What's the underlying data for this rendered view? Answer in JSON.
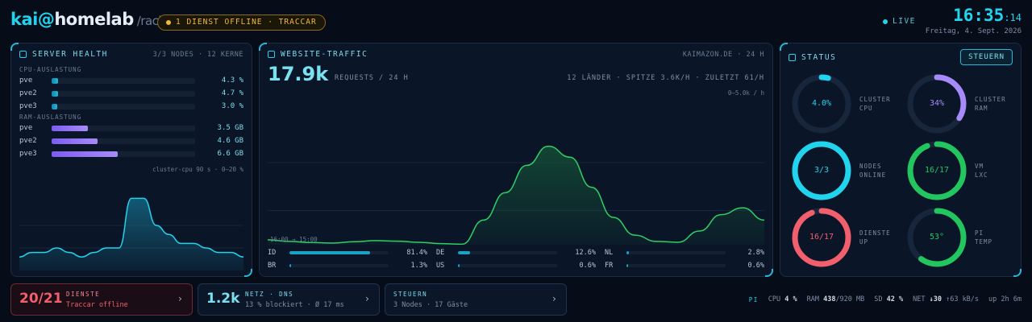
{
  "header": {
    "user": "kai@",
    "host": "homelab",
    "path": "/rack",
    "alert": "1 DIENST OFFLINE · TRACCAR",
    "live": "LIVE",
    "time": "16:35",
    "seconds": ":14",
    "date": "Freitag, 4. Sept. 2026"
  },
  "colors": {
    "accent": "#22d3ee",
    "warn": "#f4b93a",
    "ok": "#22c55e",
    "bad": "#f25f6c",
    "ram": "#a78bfa"
  },
  "server_health": {
    "title": "SERVER HEALTH",
    "meta": "3/3 NODES · 12 KERNE",
    "cpu_label": "CPU-AUSLASTUNG",
    "cpu": [
      {
        "name": "pve",
        "value": "4.3 %",
        "pct": 4.3
      },
      {
        "name": "pve2",
        "value": "4.7 %",
        "pct": 4.7
      },
      {
        "name": "pve3",
        "value": "3.0 %",
        "pct": 3.0
      }
    ],
    "ram_label": "RAM-AUSLASTUNG",
    "ram": [
      {
        "name": "pve",
        "value": "3.5 GB",
        "pct": 25
      },
      {
        "name": "pve2",
        "value": "4.6 GB",
        "pct": 32
      },
      {
        "name": "pve3",
        "value": "6.6 GB",
        "pct": 46
      }
    ],
    "chart_caption": "cluster-cpu 90 s · 0–20 %"
  },
  "traffic": {
    "title": "WEBSITE-TRAFFIC",
    "meta": "KAIMAZON.DE · 24 H",
    "total": "17.9k",
    "total_label": "REQUESTS / 24 H",
    "info": "12 LÄNDER · SPITZE 3.6K/H · ZULETZT 61/H",
    "scale": "0–5.0k / h",
    "range": "16:00 → 15:00",
    "countries": [
      {
        "code": "ID",
        "value": "81.4%",
        "pct": 81.4
      },
      {
        "code": "DE",
        "value": "12.6%",
        "pct": 12.6
      },
      {
        "code": "NL",
        "value": "2.8%",
        "pct": 2.8
      },
      {
        "code": "BR",
        "value": "1.3%",
        "pct": 1.3
      },
      {
        "code": "US",
        "value": "0.6%",
        "pct": 0.6
      },
      {
        "code": "FR",
        "value": "0.6%",
        "pct": 0.6
      }
    ]
  },
  "status": {
    "title": "STATUS",
    "button": "STEUERN",
    "gauges": [
      {
        "value": "4.0%",
        "l1": "CLUSTER",
        "l2": "CPU",
        "pct": 4,
        "color": "#22d3ee"
      },
      {
        "value": "34%",
        "l1": "CLUSTER",
        "l2": "RAM",
        "pct": 34,
        "color": "#a78bfa"
      },
      {
        "value": "3/3",
        "l1": "NODES",
        "l2": "ONLINE",
        "pct": 100,
        "color": "#22d3ee"
      },
      {
        "value": "16/17",
        "l1": "VM",
        "l2": "LXC",
        "pct": 94,
        "color": "#22c55e"
      },
      {
        "value": "16/17",
        "l1": "DIENSTE",
        "l2": "UP",
        "pct": 94,
        "color": "#f25f6c"
      },
      {
        "value": "53°",
        "l1": "PI",
        "l2": "TEMP",
        "pct": 60,
        "color": "#22c55e"
      }
    ]
  },
  "cards": {
    "dienste": {
      "big": "20/21",
      "title": "DIENSTE",
      "sub": "Traccar offline"
    },
    "netz": {
      "big": "1.2k",
      "title": "NETZ · DNS",
      "sub": "13 % blockiert · Ø 17 ms"
    },
    "steuern": {
      "title": "STEUERN",
      "sub": "3 Nodes · 17 Gäste"
    },
    "chevron": "›"
  },
  "system": {
    "label": "PI",
    "cpu_label": "CPU",
    "cpu": "4 %",
    "ram_label": "RAM",
    "ram": "438",
    "ram_total": "/920 MB",
    "sd_label": "SD",
    "sd": "42 %",
    "net_label": "NET",
    "net_down": "↓30",
    "net_up": "↑63 kB/s",
    "uptime": "up 2h 6m"
  },
  "chart_data": [
    {
      "type": "area",
      "ylabel": "cluster-cpu (%)",
      "ylim": [
        0,
        20
      ],
      "x_seconds": [
        0,
        5,
        10,
        15,
        20,
        25,
        30,
        35,
        40,
        45,
        50,
        55,
        60,
        65,
        70,
        75,
        80,
        85,
        90
      ],
      "values": [
        3,
        4,
        4,
        5,
        4,
        3,
        4,
        5,
        5,
        16,
        16,
        10,
        8,
        6,
        6,
        5,
        4,
        4,
        3
      ]
    },
    {
      "type": "area",
      "ylabel": "requests / h",
      "ylim": [
        0,
        5000
      ],
      "x": [
        "16:00",
        "17:00",
        "18:00",
        "19:00",
        "20:00",
        "21:00",
        "22:00",
        "23:00",
        "00:00",
        "01:00",
        "02:00",
        "03:00",
        "04:00",
        "05:00",
        "06:00",
        "07:00",
        "08:00",
        "09:00",
        "10:00",
        "11:00",
        "12:00",
        "13:00",
        "14:00",
        "15:00"
      ],
      "values": [
        180,
        120,
        80,
        60,
        110,
        150,
        130,
        90,
        40,
        20,
        900,
        1900,
        2900,
        3600,
        3200,
        2100,
        1000,
        350,
        120,
        90,
        500,
        1100,
        1350,
        900
      ]
    }
  ]
}
